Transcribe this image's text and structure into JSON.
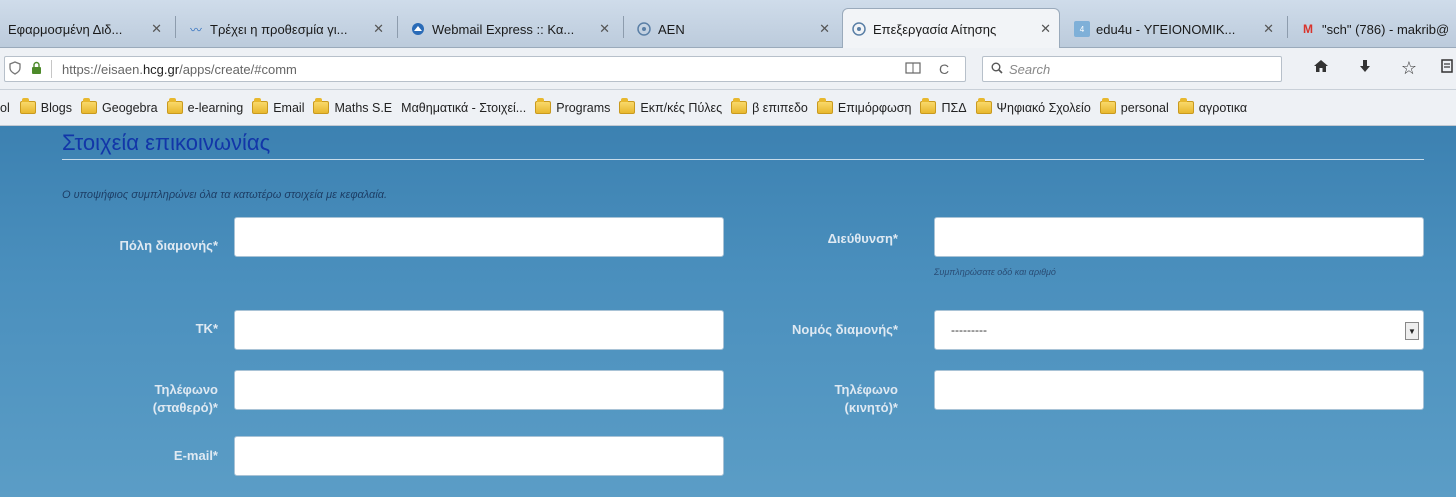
{
  "tabs": [
    {
      "label": "Εφαρμοσμένη Διδ...",
      "icon": "doc-icon",
      "active": false
    },
    {
      "label": "Τρέχει η προθεσμία γι...",
      "icon": "wave-icon",
      "active": false
    },
    {
      "label": "Webmail Express :: Κα...",
      "icon": "mail-icon",
      "active": false
    },
    {
      "label": "AEN",
      "icon": "compass-icon",
      "active": false
    },
    {
      "label": "Επεξεργασία Αίτησης",
      "icon": "compass-icon",
      "active": true
    },
    {
      "label": "edu4u - ΥΓΕΙΟΝΟΜΙΚ...",
      "icon": "edu-icon",
      "active": false
    },
    {
      "label": "\"sch\" (786) - makrib@",
      "icon": "gmail-icon",
      "active": false
    }
  ],
  "urlbar": {
    "prefix": "https://eisaen.",
    "domain": "hcg.gr",
    "suffix": "/apps/create/#comm",
    "search_placeholder": "Search"
  },
  "bookmarks": {
    "first": "ol",
    "items": [
      "Blogs",
      "Geogebra",
      "e-learning",
      "Email",
      "Maths S.E",
      "Μαθηματικά - Στοιχεί...",
      "Programs",
      "Εκπ/κές Πύλες",
      "β επιπεδο",
      "Επιμόρφωση",
      "ΠΣΔ",
      "Ψηφιακό Σχολείο",
      "personal",
      "αγροτικα"
    ]
  },
  "form": {
    "section_title": "Στοιχεία επικοινωνίας",
    "instruction": "Ο υποψήφιος συμπληρώνει όλα τα κατωτέρω στοιχεία με κεφαλαία.",
    "city_label": "Πόλη διαμονής*",
    "city_value": "",
    "address_label": "Διεύθυνση*",
    "address_value": "",
    "address_hint": "Συμπληρώσατε οδό και αριθμό",
    "zip_label": "ΤΚ*",
    "zip_value": "",
    "prefecture_label": "Νομός διαμονής*",
    "prefecture_value": "---------",
    "phone_label_1": "Τηλέφωνο",
    "phone_label_2": "(σταθερό)*",
    "phone_value": "",
    "mobile_label_1": "Τηλέφωνο",
    "mobile_label_2": "(κινητό)*",
    "mobile_value": "",
    "email_label": "E-mail*",
    "email_value": ""
  }
}
